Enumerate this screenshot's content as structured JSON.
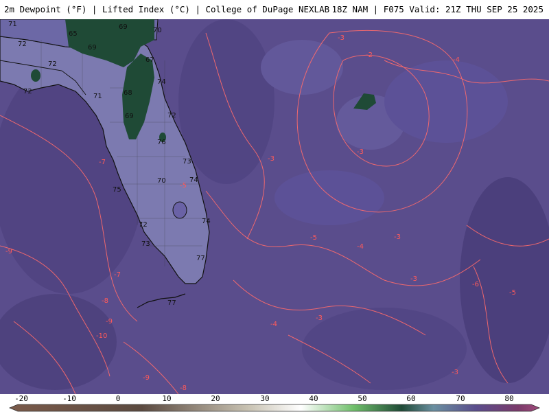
{
  "header": {
    "left_text": "2m Dewpoint (°F) | Lifted Index (°C) | College of DuPage NEXLAB",
    "right_text": "18Z NAM | F075 Valid: 21Z THU SEP 25 2025"
  },
  "colorbar": {
    "ticks": [
      "-20",
      "-10",
      "0",
      "10",
      "20",
      "30",
      "40",
      "50",
      "60",
      "70",
      "80"
    ]
  },
  "dewpoint_labels": [
    "71",
    "73",
    "65",
    "69",
    "69",
    "70",
    "72",
    "72",
    "72",
    "67",
    "71",
    "74",
    "68",
    "69",
    "72",
    "76",
    "73",
    "75",
    "70",
    "74",
    "72",
    "74",
    "73",
    "77",
    "77"
  ],
  "lifted_index_labels": [
    "-3",
    "-2",
    "-4",
    "-3",
    "-3",
    "-7",
    "-5",
    "-4",
    "-3",
    "-3",
    "-5",
    "-6",
    "-5",
    "-9",
    "-7",
    "-8",
    "-9",
    "-10",
    "-9",
    "-8",
    "-4",
    "-3",
    "-3"
  ],
  "colors": {
    "background": "#5a4d8c",
    "contour": "#ff6b6b",
    "coast": "#111111",
    "high_dewpoint": "#1f4a36",
    "land": "#7c7ab0"
  }
}
